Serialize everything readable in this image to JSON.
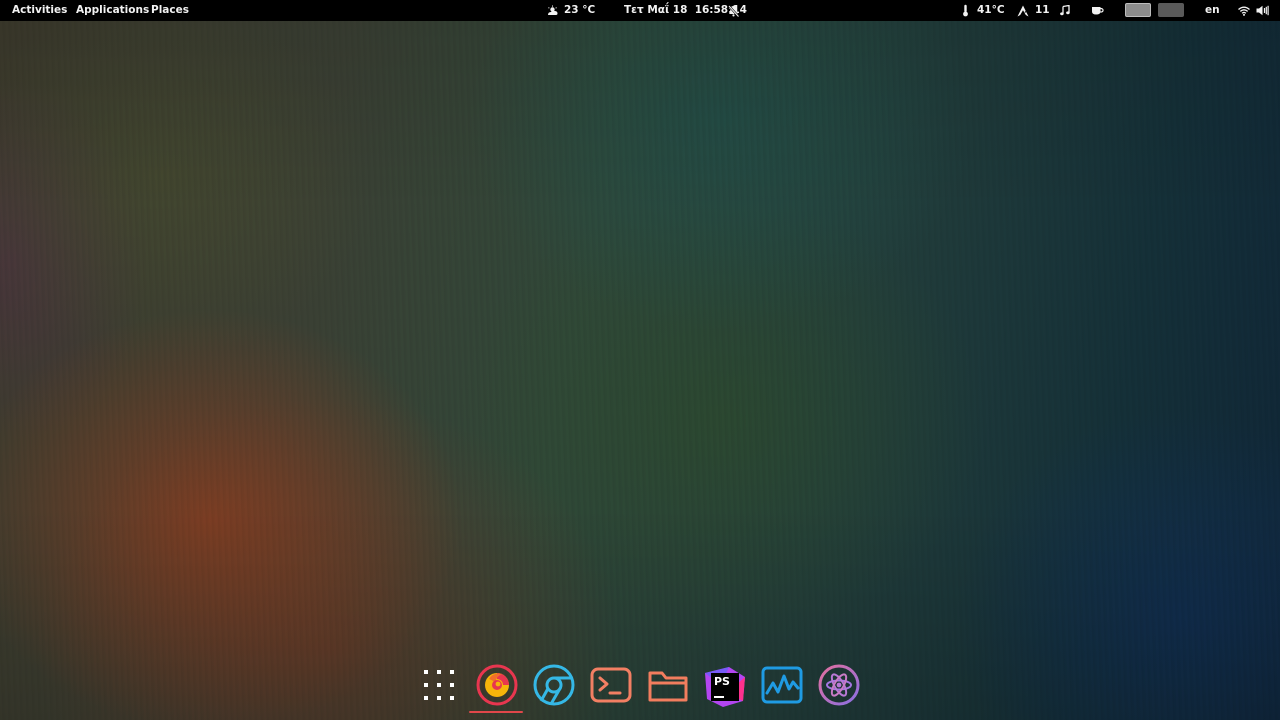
{
  "topbar": {
    "activities": "Activities",
    "applications": "Applications",
    "places": "Places",
    "weather": {
      "icon": "cloud-sun-icon",
      "temp": "23 °C"
    },
    "clock": "Τετ Μαΐ 18  16:58:14",
    "notifications_icon": "bell-muted-icon",
    "cpu_temp": {
      "icon": "thermometer-icon",
      "value": "41°C"
    },
    "updates": {
      "icon": "arch-update-icon",
      "count": "11"
    },
    "media_icon": "music-note-icon",
    "caffeine_icon": "coffee-cup-icon",
    "workspaces": [
      {
        "active": true
      },
      {
        "active": false
      }
    ],
    "keyboard_layout": "en",
    "network_icon": "wifi-icon",
    "volume_icon": "speaker-icon"
  },
  "dock": {
    "items": [
      {
        "name": "show-applications",
        "icon": "app-grid-icon",
        "running": false
      },
      {
        "name": "firefox",
        "icon": "firefox-icon",
        "running": true
      },
      {
        "name": "chromium",
        "icon": "chrome-icon",
        "running": false
      },
      {
        "name": "terminal",
        "icon": "terminal-icon",
        "running": false
      },
      {
        "name": "files",
        "icon": "folder-icon",
        "running": false
      },
      {
        "name": "phpstorm",
        "icon": "phpstorm-icon",
        "label": "PS",
        "running": false
      },
      {
        "name": "system-monitor",
        "icon": "system-monitor-icon",
        "running": false
      },
      {
        "name": "atom",
        "icon": "atom-icon",
        "running": false
      }
    ]
  },
  "colors": {
    "topbar_bg": "#000000",
    "running_indicator": "#e0474a",
    "workspace_active": "#8c8c8c",
    "workspace_inactive": "#5a5a5a"
  }
}
